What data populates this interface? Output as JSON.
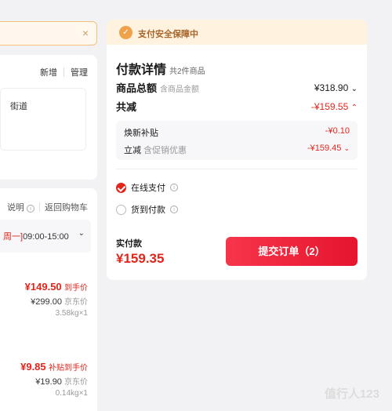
{
  "left": {
    "notice": {
      "close": "×"
    },
    "address": {
      "street": "街道",
      "add": "新增",
      "manage": "管理"
    },
    "goods": {
      "header_note": "说明",
      "back_cart": "返回购物车",
      "delivery": {
        "day": "周一]",
        "time": "09:00-15:00"
      },
      "items": [
        {
          "price": "¥149.50",
          "price_tag": "到手价",
          "orig": "¥299.00",
          "orig_tag": "京东价",
          "spec": "3.58kg×1"
        },
        {
          "price": "¥9.85",
          "price_tag": "补贴到手价",
          "orig": "¥19.90",
          "orig_tag": "京东价",
          "spec": "0.14kg×1"
        }
      ]
    }
  },
  "payment": {
    "banner": "支付安全保障中",
    "title": "付款详情",
    "item_count": "共2件商品",
    "subtotal_label": "商品总额",
    "subtotal_hint": "含商品金额",
    "subtotal": "¥318.90",
    "discount_label": "共减",
    "discount": "-¥159.55",
    "sub_items": [
      {
        "label": "焕新补贴",
        "hint": "",
        "value": "-¥0.10"
      },
      {
        "label": "立减",
        "hint": "含促销优惠",
        "value": "-¥159.45"
      }
    ],
    "methods": [
      {
        "label": "在线支付",
        "selected": true
      },
      {
        "label": "货到付款",
        "selected": false
      }
    ],
    "total_label": "实付款",
    "total": "¥159.35",
    "submit": "提交订单（2）"
  },
  "watermark": "值行人123",
  "colors": {
    "accent": "#e1251b",
    "banner": "#fff3e0"
  }
}
